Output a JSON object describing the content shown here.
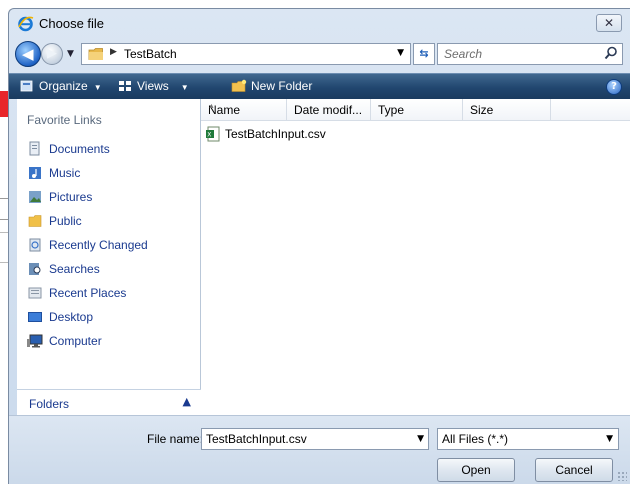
{
  "window": {
    "title": "Choose file",
    "close_label": "✕"
  },
  "address": {
    "current_folder": "TestBatch"
  },
  "search": {
    "placeholder": "Search"
  },
  "toolbar": {
    "organize": "Organize",
    "views": "Views",
    "new_folder": "New Folder",
    "help": "?"
  },
  "favorites": {
    "header": "Favorite Links",
    "items": [
      {
        "label": "Documents",
        "icon": "documents-icon"
      },
      {
        "label": "Music",
        "icon": "music-icon"
      },
      {
        "label": "Pictures",
        "icon": "pictures-icon"
      },
      {
        "label": "Public",
        "icon": "public-folder-icon"
      },
      {
        "label": "Recently Changed",
        "icon": "recently-changed-icon"
      },
      {
        "label": "Searches",
        "icon": "searches-icon"
      },
      {
        "label": "Recent Places",
        "icon": "recent-places-icon"
      },
      {
        "label": "Desktop",
        "icon": "desktop-icon"
      },
      {
        "label": "Computer",
        "icon": "computer-icon"
      }
    ]
  },
  "folders": {
    "label": "Folders"
  },
  "file_list": {
    "columns": [
      "Name",
      "Date modif...",
      "Type",
      "Size"
    ],
    "files": [
      {
        "name": "TestBatchInput.csv",
        "icon": "csv-file-icon"
      }
    ]
  },
  "bottom": {
    "file_name_label": "File name:",
    "file_name_value": "TestBatchInput.csv",
    "filter_value": "All Files (*.*)",
    "open_label": "Open",
    "cancel_label": "Cancel"
  },
  "colors": {
    "toolbar": "#21466f",
    "link": "#1a3a8f",
    "background_accent": "#e8262a"
  }
}
